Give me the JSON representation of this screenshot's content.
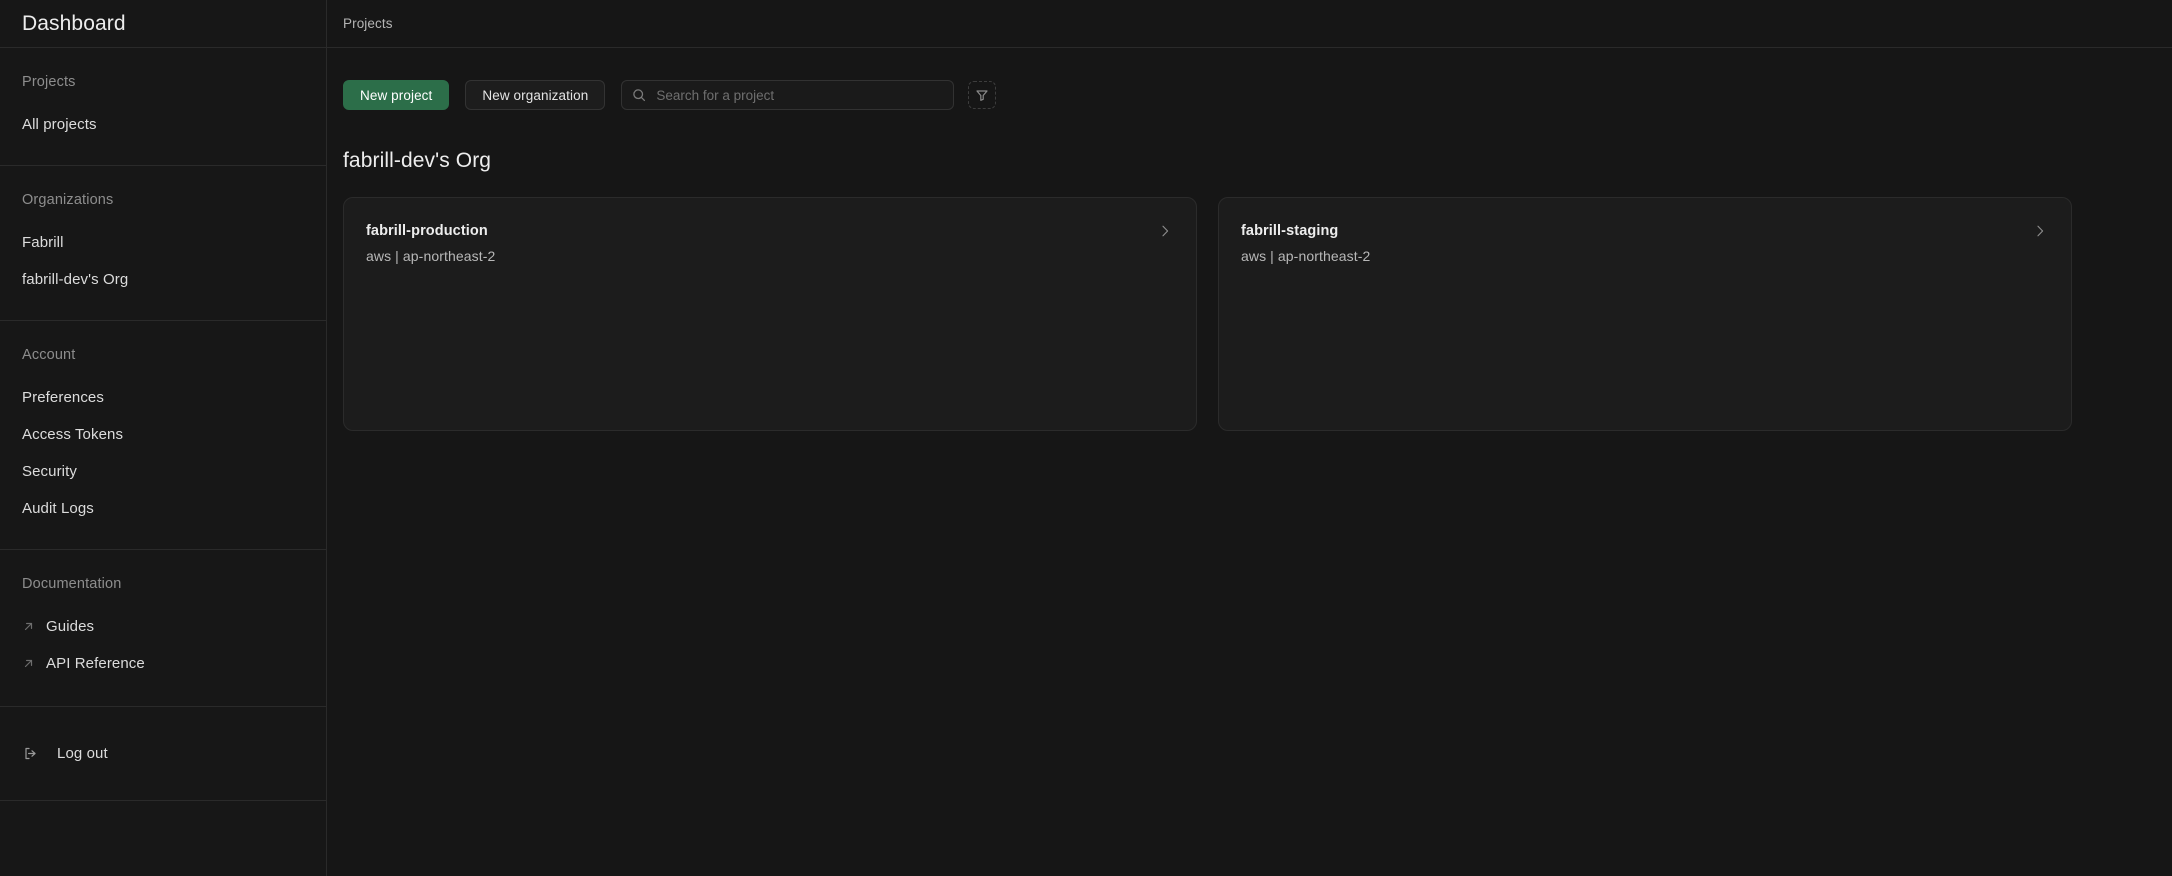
{
  "sidebar": {
    "title": "Dashboard",
    "sections": [
      {
        "label": "Projects",
        "items": [
          {
            "label": "All projects",
            "icon": "none"
          }
        ]
      },
      {
        "label": "Organizations",
        "items": [
          {
            "label": "Fabrill",
            "icon": "none"
          },
          {
            "label": "fabrill-dev's Org",
            "icon": "none"
          }
        ]
      },
      {
        "label": "Account",
        "items": [
          {
            "label": "Preferences",
            "icon": "none"
          },
          {
            "label": "Access Tokens",
            "icon": "none"
          },
          {
            "label": "Security",
            "icon": "none"
          },
          {
            "label": "Audit Logs",
            "icon": "none"
          }
        ]
      },
      {
        "label": "Documentation",
        "items": [
          {
            "label": "Guides",
            "icon": "external-link-icon"
          },
          {
            "label": "API Reference",
            "icon": "external-link-icon"
          }
        ]
      }
    ],
    "logout": {
      "label": "Log out",
      "icon": "logout-icon"
    }
  },
  "breadcrumb": {
    "items": [
      "Projects"
    ]
  },
  "toolbar": {
    "new_project_label": "New project",
    "new_organization_label": "New organization",
    "search_placeholder": "Search for a project",
    "search_value": "",
    "search_icon": "search-icon",
    "filter_icon": "filter-funnel-icon"
  },
  "main": {
    "org_title": "fabrill-dev's Org",
    "projects": [
      {
        "name": "fabrill-production",
        "meta": "aws | ap-northeast-2",
        "chevron_icon": "chevron-right-icon"
      },
      {
        "name": "fabrill-staging",
        "meta": "aws | ap-northeast-2",
        "chevron_icon": "chevron-right-icon"
      }
    ]
  },
  "colors": {
    "page_bg": "#161616",
    "sidebar_bg": "#171717",
    "card_bg": "#1c1c1c",
    "border": "#2a2a2a",
    "accent_green": "#2c6e49",
    "text_primary": "#ededed",
    "text_muted": "#8d8d8d"
  }
}
